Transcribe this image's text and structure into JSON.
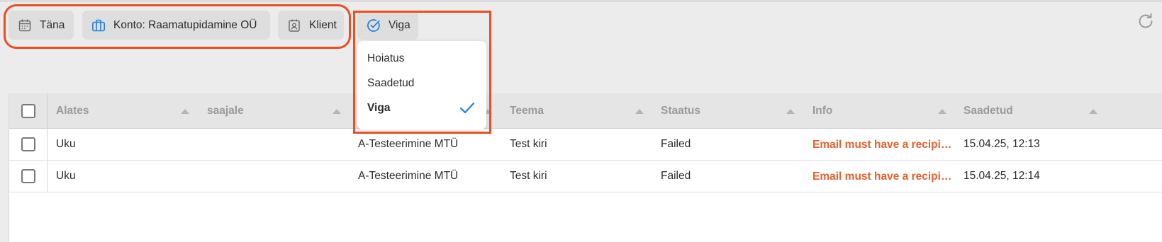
{
  "filters": {
    "date_label": "Täna",
    "account_label": "Konto: Raamatupidamine OÜ",
    "client_label": "Klient",
    "status_label": "Viga"
  },
  "status_menu": {
    "options": [
      {
        "label": "Hoiatus",
        "selected": false
      },
      {
        "label": "Saadetud",
        "selected": false
      },
      {
        "label": "Viga",
        "selected": true
      }
    ]
  },
  "table": {
    "columns": [
      "Alates",
      "saajale",
      "",
      "Teema",
      "Staatus",
      "Info",
      "Saadetud"
    ],
    "rows": [
      {
        "from": "Uku",
        "to": "",
        "company": "A-Testeerimine MTÜ",
        "subject": "Test kiri",
        "status": "Failed",
        "info": "Email must have a recipient",
        "sent": "15.04.25, 12:13"
      },
      {
        "from": "Uku",
        "to": "",
        "company": "A-Testeerimine MTÜ",
        "subject": "Test kiri",
        "status": "Failed",
        "info": "Email must have a recipient",
        "sent": "15.04.25, 12:14"
      }
    ]
  },
  "colors": {
    "accent": "#1e7fe0",
    "highlight": "#ea4e21",
    "error_text": "#e8602c"
  },
  "icons": {
    "date": "calendar-icon",
    "account": "briefcase-icon",
    "client": "contact-card-icon",
    "status": "check-circle-icon",
    "refresh": "refresh-icon"
  }
}
